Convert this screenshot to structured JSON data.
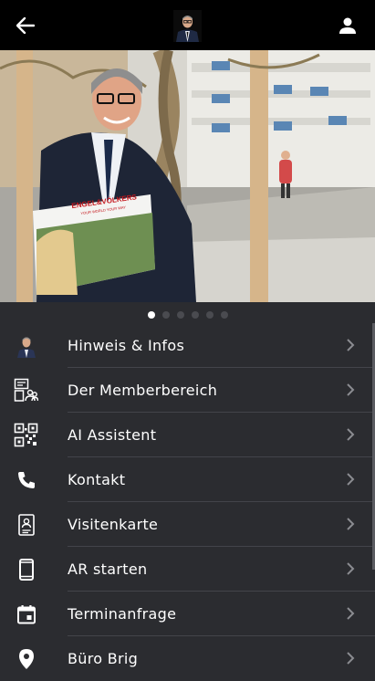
{
  "header": {
    "back_icon": "arrow-left-icon",
    "logo": "agent-avatar",
    "profile_icon": "person-icon"
  },
  "hero": {
    "poster_brand": "ENGEL&VÖLKERS",
    "poster_tagline": "YOUR WORLD YOUR WAY"
  },
  "carousel": {
    "count": 6,
    "active_index": 0
  },
  "menu": {
    "items": [
      {
        "label": "Hinweis & Infos",
        "icon": "avatar-photo"
      },
      {
        "label": "Der Memberbereich",
        "icon": "member-area-icon"
      },
      {
        "label": "AI Assistent",
        "icon": "qr-code-icon"
      },
      {
        "label": "Kontakt",
        "icon": "phone-icon"
      },
      {
        "label": "Visitenkarte",
        "icon": "contact-card-icon"
      },
      {
        "label": "AR starten",
        "icon": "smartphone-icon"
      },
      {
        "label": "Terminanfrage",
        "icon": "calendar-icon"
      },
      {
        "label": "Büro Brig",
        "icon": "location-pin-icon"
      }
    ]
  },
  "colors": {
    "background": "#2b2c30",
    "topbar": "#000000",
    "divider": "#43444a",
    "chevron": "#8b8c91"
  }
}
